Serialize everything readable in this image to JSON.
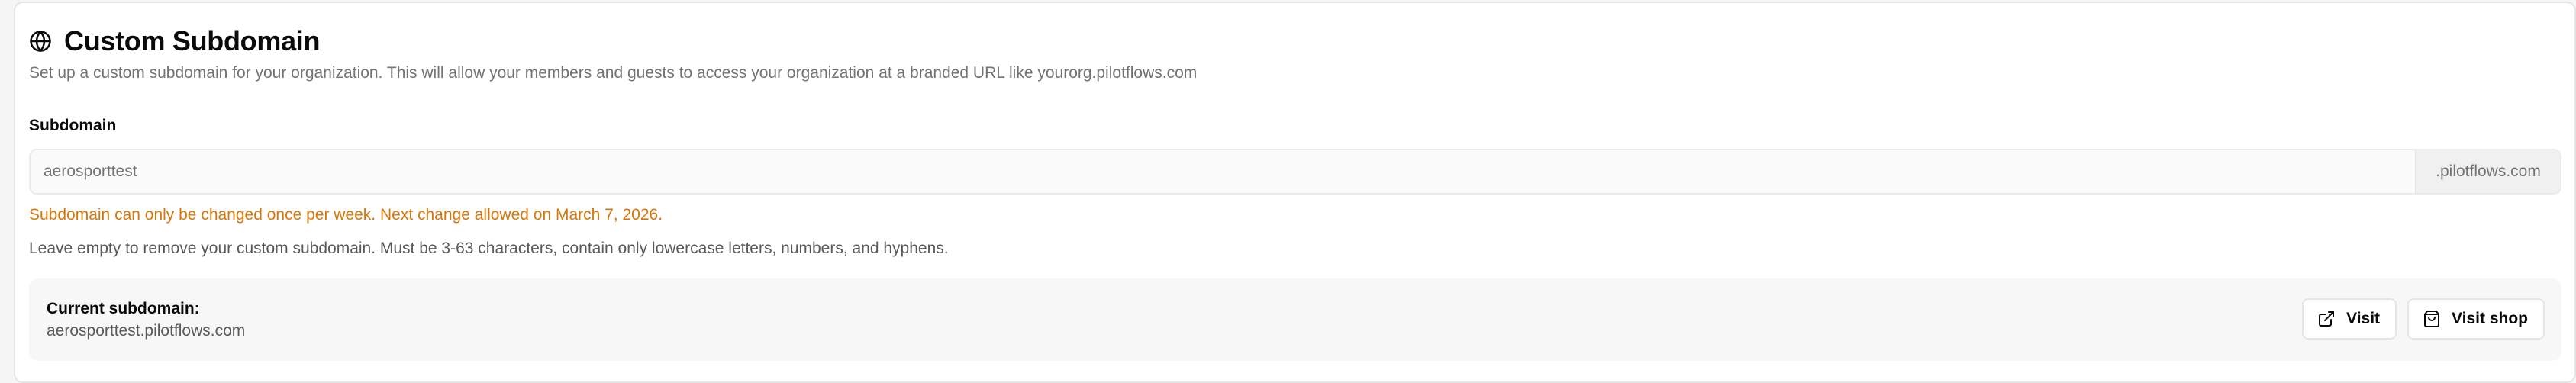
{
  "section": {
    "title": "Custom Subdomain",
    "icon": "globe-icon",
    "description": "Set up a custom subdomain for your organization. This will allow your members and guests to access your organization at a branded URL like yourorg.pilotflows.com"
  },
  "field": {
    "label": "Subdomain",
    "value": "",
    "placeholder": "aerosporttest",
    "suffix": ".pilotflows.com",
    "warning": "Subdomain can only be changed once per week. Next change allowed on March 7, 2026.",
    "help": "Leave empty to remove your custom subdomain. Must be 3-63 characters, contain only lowercase letters, numbers, and hyphens."
  },
  "current": {
    "label": "Current subdomain:",
    "value": "aerosporttest.pilotflows.com",
    "visit_label": "Visit",
    "visit_icon": "external-link-icon",
    "visit_shop_label": "Visit shop",
    "visit_shop_icon": "shopping-bag-icon"
  },
  "colors": {
    "warning": "#d97706",
    "muted_text": "#737373",
    "border": "#e5e5e5"
  }
}
